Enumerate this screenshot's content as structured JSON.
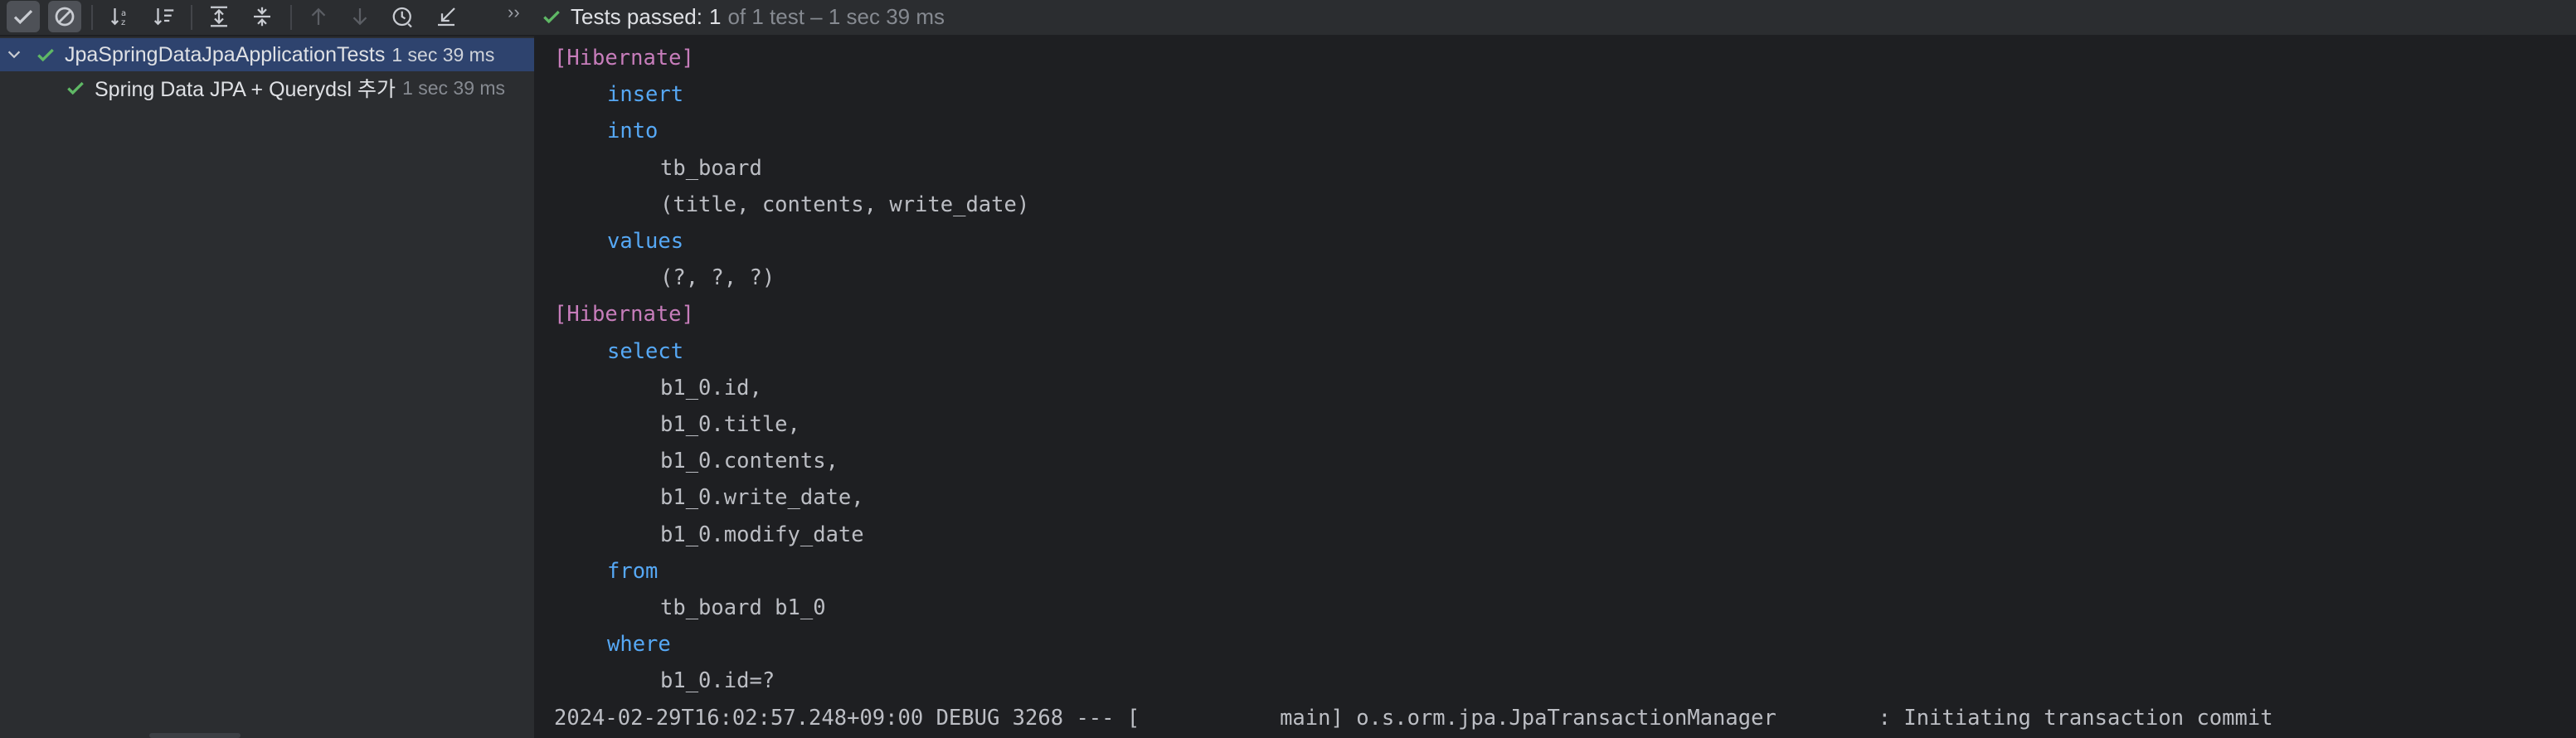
{
  "toolbar": {
    "buttons": [
      {
        "icon": "check-icon",
        "state": "pressed"
      },
      {
        "icon": "ignore-icon",
        "state": "pressed"
      },
      {
        "icon": "sort-alpha-icon"
      },
      {
        "icon": "sort-duration-icon"
      },
      {
        "icon": "expand-all-icon"
      },
      {
        "icon": "collapse-all-icon"
      },
      {
        "icon": "arrow-up-icon",
        "state": "disabled"
      },
      {
        "icon": "arrow-down-icon",
        "state": "disabled"
      },
      {
        "icon": "history-icon"
      },
      {
        "icon": "import-icon"
      }
    ],
    "more": "››",
    "status": {
      "label": "Tests passed:",
      "count": "1",
      "detail": "of 1 test – 1 sec 39 ms"
    }
  },
  "tree": {
    "items": [
      {
        "name": "JpaSpringDataJpaApplicationTests",
        "time": "1 sec 39 ms",
        "selected": true
      },
      {
        "name": "Spring Data JPA + Querydsl 추가",
        "time": "1 sec 39 ms",
        "selected": false
      }
    ]
  },
  "console": {
    "lines": [
      {
        "indent": 0,
        "kind": "tag",
        "text": "[Hibernate]"
      },
      {
        "indent": 1,
        "kind": "kw",
        "text": "insert"
      },
      {
        "indent": 1,
        "kind": "kw",
        "text": "into"
      },
      {
        "indent": 2,
        "kind": "plain",
        "text": "tb_board"
      },
      {
        "indent": 2,
        "kind": "plain",
        "text": "(title, contents, write_date)"
      },
      {
        "indent": 1,
        "kind": "kw",
        "text": "values"
      },
      {
        "indent": 2,
        "kind": "plain",
        "text": "(?, ?, ?)"
      },
      {
        "indent": 0,
        "kind": "tag",
        "text": "[Hibernate]"
      },
      {
        "indent": 1,
        "kind": "kw",
        "text": "select"
      },
      {
        "indent": 2,
        "kind": "plain",
        "text": "b1_0.id,"
      },
      {
        "indent": 2,
        "kind": "plain",
        "text": "b1_0.title,"
      },
      {
        "indent": 2,
        "kind": "plain",
        "text": "b1_0.contents,"
      },
      {
        "indent": 2,
        "kind": "plain",
        "text": "b1_0.write_date,"
      },
      {
        "indent": 2,
        "kind": "plain",
        "text": "b1_0.modify_date"
      },
      {
        "indent": 1,
        "kind": "kw",
        "text": "from"
      },
      {
        "indent": 2,
        "kind": "plain",
        "text": "tb_board b1_0"
      },
      {
        "indent": 1,
        "kind": "kw",
        "text": "where"
      },
      {
        "indent": 2,
        "kind": "plain",
        "text": "b1_0.id=?"
      },
      {
        "indent": 0,
        "kind": "plain",
        "text": "2024-02-29T16:02:57.248+09:00 DEBUG 3268 --- [           main] o.s.orm.jpa.JpaTransactionManager        : Initiating transaction commit"
      }
    ]
  },
  "colors": {
    "toolbar_bg": "#2b2d30",
    "console_bg": "#1e1f22",
    "selection": "#2e436e",
    "success_green": "#5fb865",
    "hibernate_tag": "#c77dbb",
    "sql_keyword": "#56a8f5",
    "text": "#bcbec4"
  }
}
